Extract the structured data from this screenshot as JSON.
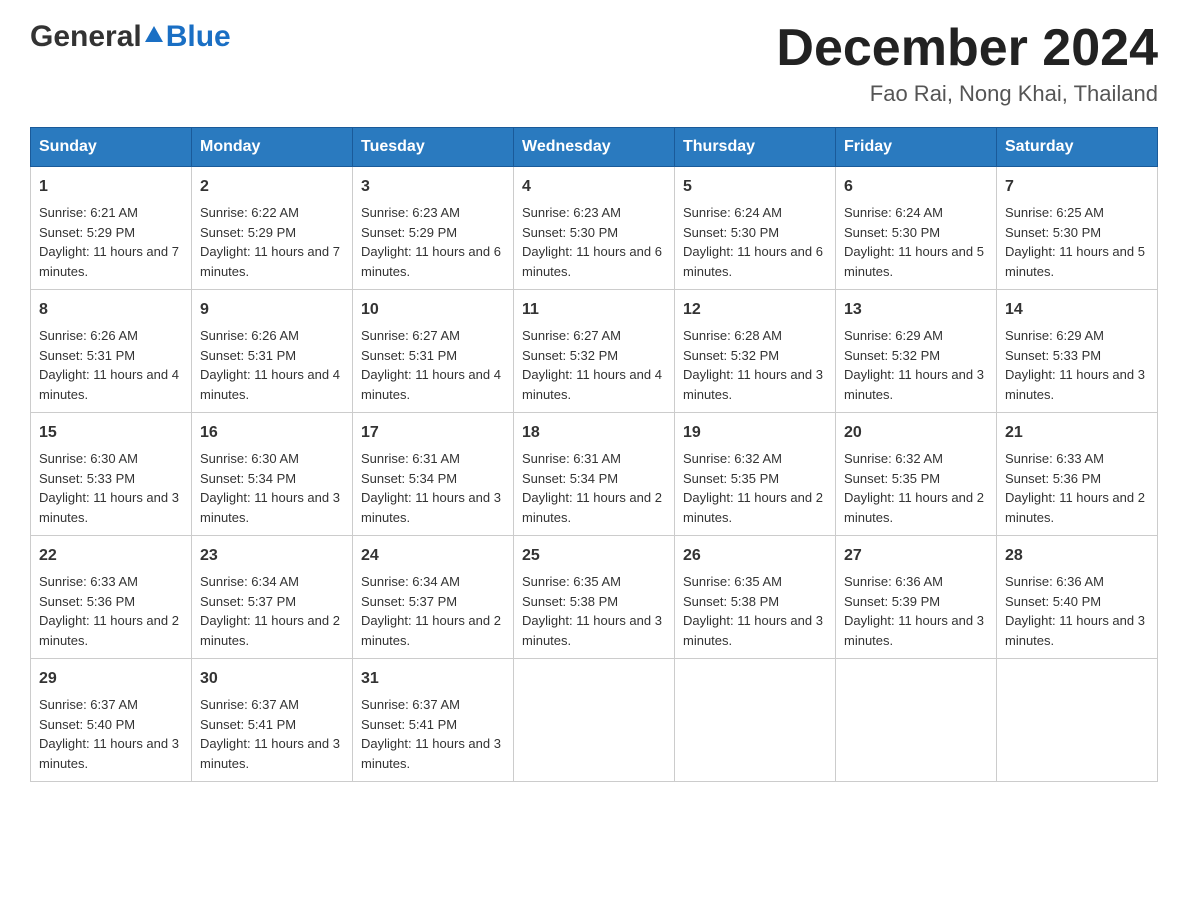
{
  "header": {
    "logo_general": "General",
    "logo_blue": "Blue",
    "month_title": "December 2024",
    "location": "Fao Rai, Nong Khai, Thailand"
  },
  "days_of_week": [
    "Sunday",
    "Monday",
    "Tuesday",
    "Wednesday",
    "Thursday",
    "Friday",
    "Saturday"
  ],
  "weeks": [
    [
      {
        "day": "1",
        "sunrise": "6:21 AM",
        "sunset": "5:29 PM",
        "daylight": "11 hours and 7 minutes."
      },
      {
        "day": "2",
        "sunrise": "6:22 AM",
        "sunset": "5:29 PM",
        "daylight": "11 hours and 7 minutes."
      },
      {
        "day": "3",
        "sunrise": "6:23 AM",
        "sunset": "5:29 PM",
        "daylight": "11 hours and 6 minutes."
      },
      {
        "day": "4",
        "sunrise": "6:23 AM",
        "sunset": "5:30 PM",
        "daylight": "11 hours and 6 minutes."
      },
      {
        "day": "5",
        "sunrise": "6:24 AM",
        "sunset": "5:30 PM",
        "daylight": "11 hours and 6 minutes."
      },
      {
        "day": "6",
        "sunrise": "6:24 AM",
        "sunset": "5:30 PM",
        "daylight": "11 hours and 5 minutes."
      },
      {
        "day": "7",
        "sunrise": "6:25 AM",
        "sunset": "5:30 PM",
        "daylight": "11 hours and 5 minutes."
      }
    ],
    [
      {
        "day": "8",
        "sunrise": "6:26 AM",
        "sunset": "5:31 PM",
        "daylight": "11 hours and 4 minutes."
      },
      {
        "day": "9",
        "sunrise": "6:26 AM",
        "sunset": "5:31 PM",
        "daylight": "11 hours and 4 minutes."
      },
      {
        "day": "10",
        "sunrise": "6:27 AM",
        "sunset": "5:31 PM",
        "daylight": "11 hours and 4 minutes."
      },
      {
        "day": "11",
        "sunrise": "6:27 AM",
        "sunset": "5:32 PM",
        "daylight": "11 hours and 4 minutes."
      },
      {
        "day": "12",
        "sunrise": "6:28 AM",
        "sunset": "5:32 PM",
        "daylight": "11 hours and 3 minutes."
      },
      {
        "day": "13",
        "sunrise": "6:29 AM",
        "sunset": "5:32 PM",
        "daylight": "11 hours and 3 minutes."
      },
      {
        "day": "14",
        "sunrise": "6:29 AM",
        "sunset": "5:33 PM",
        "daylight": "11 hours and 3 minutes."
      }
    ],
    [
      {
        "day": "15",
        "sunrise": "6:30 AM",
        "sunset": "5:33 PM",
        "daylight": "11 hours and 3 minutes."
      },
      {
        "day": "16",
        "sunrise": "6:30 AM",
        "sunset": "5:34 PM",
        "daylight": "11 hours and 3 minutes."
      },
      {
        "day": "17",
        "sunrise": "6:31 AM",
        "sunset": "5:34 PM",
        "daylight": "11 hours and 3 minutes."
      },
      {
        "day": "18",
        "sunrise": "6:31 AM",
        "sunset": "5:34 PM",
        "daylight": "11 hours and 2 minutes."
      },
      {
        "day": "19",
        "sunrise": "6:32 AM",
        "sunset": "5:35 PM",
        "daylight": "11 hours and 2 minutes."
      },
      {
        "day": "20",
        "sunrise": "6:32 AM",
        "sunset": "5:35 PM",
        "daylight": "11 hours and 2 minutes."
      },
      {
        "day": "21",
        "sunrise": "6:33 AM",
        "sunset": "5:36 PM",
        "daylight": "11 hours and 2 minutes."
      }
    ],
    [
      {
        "day": "22",
        "sunrise": "6:33 AM",
        "sunset": "5:36 PM",
        "daylight": "11 hours and 2 minutes."
      },
      {
        "day": "23",
        "sunrise": "6:34 AM",
        "sunset": "5:37 PM",
        "daylight": "11 hours and 2 minutes."
      },
      {
        "day": "24",
        "sunrise": "6:34 AM",
        "sunset": "5:37 PM",
        "daylight": "11 hours and 2 minutes."
      },
      {
        "day": "25",
        "sunrise": "6:35 AM",
        "sunset": "5:38 PM",
        "daylight": "11 hours and 3 minutes."
      },
      {
        "day": "26",
        "sunrise": "6:35 AM",
        "sunset": "5:38 PM",
        "daylight": "11 hours and 3 minutes."
      },
      {
        "day": "27",
        "sunrise": "6:36 AM",
        "sunset": "5:39 PM",
        "daylight": "11 hours and 3 minutes."
      },
      {
        "day": "28",
        "sunrise": "6:36 AM",
        "sunset": "5:40 PM",
        "daylight": "11 hours and 3 minutes."
      }
    ],
    [
      {
        "day": "29",
        "sunrise": "6:37 AM",
        "sunset": "5:40 PM",
        "daylight": "11 hours and 3 minutes."
      },
      {
        "day": "30",
        "sunrise": "6:37 AM",
        "sunset": "5:41 PM",
        "daylight": "11 hours and 3 minutes."
      },
      {
        "day": "31",
        "sunrise": "6:37 AM",
        "sunset": "5:41 PM",
        "daylight": "11 hours and 3 minutes."
      },
      null,
      null,
      null,
      null
    ]
  ]
}
